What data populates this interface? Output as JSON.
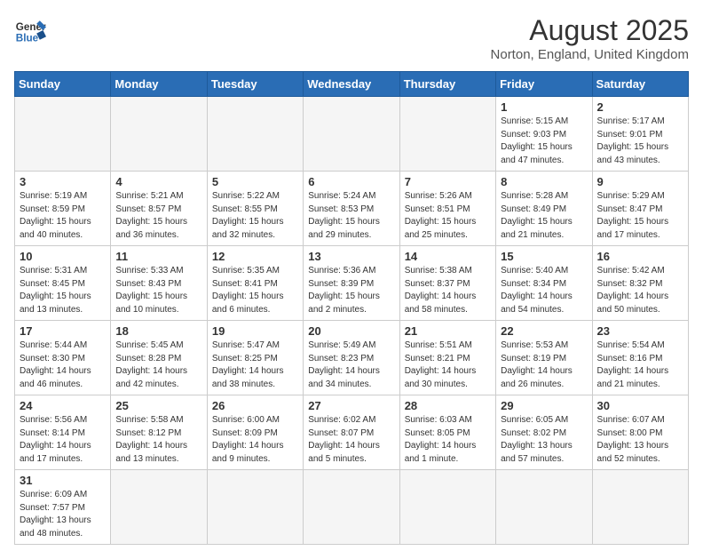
{
  "header": {
    "logo_general": "General",
    "logo_blue": "Blue",
    "month_year": "August 2025",
    "location": "Norton, England, United Kingdom"
  },
  "weekdays": [
    "Sunday",
    "Monday",
    "Tuesday",
    "Wednesday",
    "Thursday",
    "Friday",
    "Saturday"
  ],
  "weeks": [
    [
      {
        "day": "",
        "info": ""
      },
      {
        "day": "",
        "info": ""
      },
      {
        "day": "",
        "info": ""
      },
      {
        "day": "",
        "info": ""
      },
      {
        "day": "",
        "info": ""
      },
      {
        "day": "1",
        "info": "Sunrise: 5:15 AM\nSunset: 9:03 PM\nDaylight: 15 hours and 47 minutes."
      },
      {
        "day": "2",
        "info": "Sunrise: 5:17 AM\nSunset: 9:01 PM\nDaylight: 15 hours and 43 minutes."
      }
    ],
    [
      {
        "day": "3",
        "info": "Sunrise: 5:19 AM\nSunset: 8:59 PM\nDaylight: 15 hours and 40 minutes."
      },
      {
        "day": "4",
        "info": "Sunrise: 5:21 AM\nSunset: 8:57 PM\nDaylight: 15 hours and 36 minutes."
      },
      {
        "day": "5",
        "info": "Sunrise: 5:22 AM\nSunset: 8:55 PM\nDaylight: 15 hours and 32 minutes."
      },
      {
        "day": "6",
        "info": "Sunrise: 5:24 AM\nSunset: 8:53 PM\nDaylight: 15 hours and 29 minutes."
      },
      {
        "day": "7",
        "info": "Sunrise: 5:26 AM\nSunset: 8:51 PM\nDaylight: 15 hours and 25 minutes."
      },
      {
        "day": "8",
        "info": "Sunrise: 5:28 AM\nSunset: 8:49 PM\nDaylight: 15 hours and 21 minutes."
      },
      {
        "day": "9",
        "info": "Sunrise: 5:29 AM\nSunset: 8:47 PM\nDaylight: 15 hours and 17 minutes."
      }
    ],
    [
      {
        "day": "10",
        "info": "Sunrise: 5:31 AM\nSunset: 8:45 PM\nDaylight: 15 hours and 13 minutes."
      },
      {
        "day": "11",
        "info": "Sunrise: 5:33 AM\nSunset: 8:43 PM\nDaylight: 15 hours and 10 minutes."
      },
      {
        "day": "12",
        "info": "Sunrise: 5:35 AM\nSunset: 8:41 PM\nDaylight: 15 hours and 6 minutes."
      },
      {
        "day": "13",
        "info": "Sunrise: 5:36 AM\nSunset: 8:39 PM\nDaylight: 15 hours and 2 minutes."
      },
      {
        "day": "14",
        "info": "Sunrise: 5:38 AM\nSunset: 8:37 PM\nDaylight: 14 hours and 58 minutes."
      },
      {
        "day": "15",
        "info": "Sunrise: 5:40 AM\nSunset: 8:34 PM\nDaylight: 14 hours and 54 minutes."
      },
      {
        "day": "16",
        "info": "Sunrise: 5:42 AM\nSunset: 8:32 PM\nDaylight: 14 hours and 50 minutes."
      }
    ],
    [
      {
        "day": "17",
        "info": "Sunrise: 5:44 AM\nSunset: 8:30 PM\nDaylight: 14 hours and 46 minutes."
      },
      {
        "day": "18",
        "info": "Sunrise: 5:45 AM\nSunset: 8:28 PM\nDaylight: 14 hours and 42 minutes."
      },
      {
        "day": "19",
        "info": "Sunrise: 5:47 AM\nSunset: 8:25 PM\nDaylight: 14 hours and 38 minutes."
      },
      {
        "day": "20",
        "info": "Sunrise: 5:49 AM\nSunset: 8:23 PM\nDaylight: 14 hours and 34 minutes."
      },
      {
        "day": "21",
        "info": "Sunrise: 5:51 AM\nSunset: 8:21 PM\nDaylight: 14 hours and 30 minutes."
      },
      {
        "day": "22",
        "info": "Sunrise: 5:53 AM\nSunset: 8:19 PM\nDaylight: 14 hours and 26 minutes."
      },
      {
        "day": "23",
        "info": "Sunrise: 5:54 AM\nSunset: 8:16 PM\nDaylight: 14 hours and 21 minutes."
      }
    ],
    [
      {
        "day": "24",
        "info": "Sunrise: 5:56 AM\nSunset: 8:14 PM\nDaylight: 14 hours and 17 minutes."
      },
      {
        "day": "25",
        "info": "Sunrise: 5:58 AM\nSunset: 8:12 PM\nDaylight: 14 hours and 13 minutes."
      },
      {
        "day": "26",
        "info": "Sunrise: 6:00 AM\nSunset: 8:09 PM\nDaylight: 14 hours and 9 minutes."
      },
      {
        "day": "27",
        "info": "Sunrise: 6:02 AM\nSunset: 8:07 PM\nDaylight: 14 hours and 5 minutes."
      },
      {
        "day": "28",
        "info": "Sunrise: 6:03 AM\nSunset: 8:05 PM\nDaylight: 14 hours and 1 minute."
      },
      {
        "day": "29",
        "info": "Sunrise: 6:05 AM\nSunset: 8:02 PM\nDaylight: 13 hours and 57 minutes."
      },
      {
        "day": "30",
        "info": "Sunrise: 6:07 AM\nSunset: 8:00 PM\nDaylight: 13 hours and 52 minutes."
      }
    ],
    [
      {
        "day": "31",
        "info": "Sunrise: 6:09 AM\nSunset: 7:57 PM\nDaylight: 13 hours and 48 minutes."
      },
      {
        "day": "",
        "info": ""
      },
      {
        "day": "",
        "info": ""
      },
      {
        "day": "",
        "info": ""
      },
      {
        "day": "",
        "info": ""
      },
      {
        "day": "",
        "info": ""
      },
      {
        "day": "",
        "info": ""
      }
    ]
  ]
}
